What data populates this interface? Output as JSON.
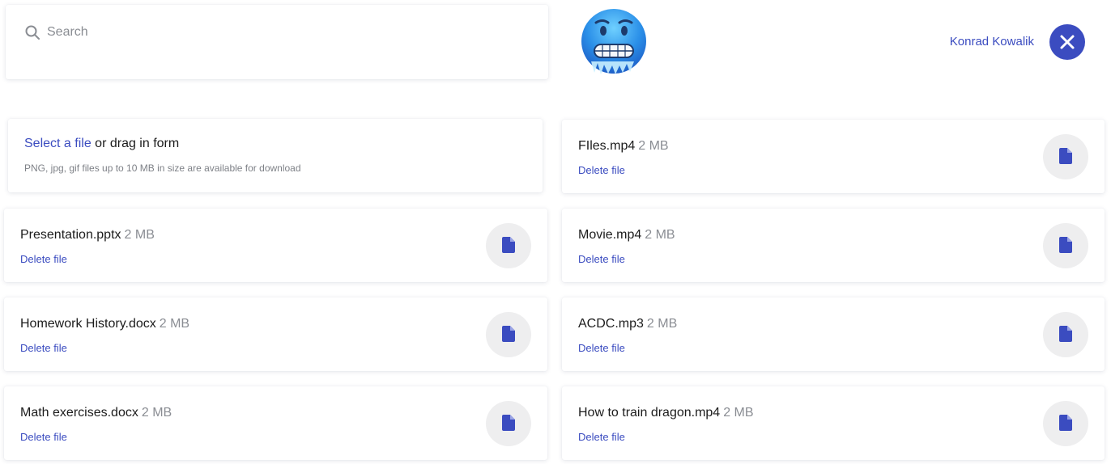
{
  "search": {
    "placeholder": "Search",
    "value": ""
  },
  "user": {
    "name": "Konrad Kowalik",
    "avatar": "cold-face-emoji"
  },
  "upload": {
    "select_label": "Select a file",
    "rest_label": " or drag in form",
    "hint": "PNG, jpg, gif files up to 10 MB in size are available for download"
  },
  "files_left": [
    {
      "name": "Presentation.pptx",
      "size": "2 MB",
      "delete": "Delete file"
    },
    {
      "name": "Homework History.docx",
      "size": "2 MB",
      "delete": "Delete file"
    },
    {
      "name": "Math exercises.docx",
      "size": "2 MB",
      "delete": "Delete file"
    }
  ],
  "files_right": [
    {
      "name": "FIles.mp4",
      "size": "2 MB",
      "delete": "Delete file"
    },
    {
      "name": "Movie.mp4",
      "size": "2 MB",
      "delete": "Delete file"
    },
    {
      "name": "ACDC.mp3",
      "size": "2 MB",
      "delete": "Delete file"
    },
    {
      "name": "How to train dragon.mp4",
      "size": "2 MB",
      "delete": "Delete file"
    }
  ],
  "icons": {
    "search": "search-icon",
    "close": "close-icon",
    "file": "document-icon"
  },
  "colors": {
    "accent": "#3b4cc0",
    "muted": "#8a8d93",
    "icon_bg": "#eeeeef"
  }
}
